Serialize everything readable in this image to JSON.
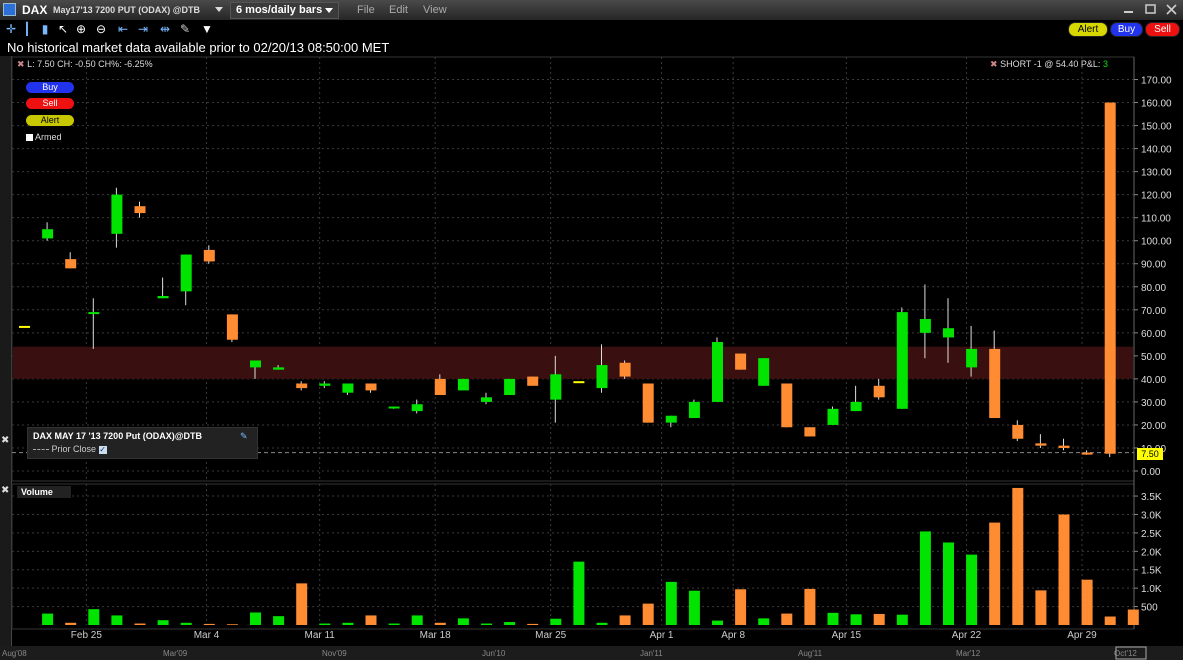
{
  "title_bar": {
    "symbol": "DAX",
    "contract": "May17'13 7200 PUT (ODAX) @DTB",
    "period": "6 mos/daily bars",
    "menu": [
      "File",
      "Edit",
      "View"
    ]
  },
  "toolbar": {
    "icons": [
      "crosshair-icon",
      "bar-chart-icon",
      "candle-chart-icon",
      "pointer-icon",
      "zoom-in-icon",
      "zoom-out-icon",
      "scroll-left-icon",
      "scroll-right-icon",
      "settings-icon",
      "dropdown-icon"
    ],
    "alert_label": "Alert",
    "buy_label": "Buy",
    "sell_label": "Sell"
  },
  "message": "No historical market data available prior to 02/20/13 08:50:00 MET",
  "price_header": {
    "stats": "L: 7.50 CH: -0.50 CH%: -6.25%",
    "position": "SHORT -1 @ 54.40 P&L:",
    "pnl": "3"
  },
  "quick_buttons": {
    "buy": "Buy",
    "sell": "Sell",
    "alert": "Alert",
    "armed": "Armed"
  },
  "legend": {
    "title": "DAX MAY 17 '13 7200 Put (ODAX)@DTB",
    "prior_close": "Prior Close"
  },
  "last_price_tag": "7.50",
  "volume_panel_title": "Volume",
  "colors": {
    "up": "#00e400",
    "down": "#ff8c32",
    "band": "#3a0f0f",
    "last_tag": "#ffff00"
  },
  "chart_data": [
    {
      "type": "candlestick",
      "ylim": [
        0,
        175
      ],
      "yticks": [
        "0.00",
        "10.00",
        "20.00",
        "30.00",
        "40.00",
        "50.00",
        "60.00",
        "70.00",
        "80.00",
        "90.00",
        "100.00",
        "110.00",
        "120.00",
        "130.00",
        "140.00",
        "150.00",
        "160.00",
        "170.00"
      ],
      "date_labels": [
        "Feb 25",
        "Mar 4",
        "Mar 11",
        "Mar 18",
        "Mar 25",
        "Apr 1",
        "Apr 8",
        "Apr 15",
        "Apr 22",
        "Apr 29"
      ],
      "overview_labels": [
        "Aug'08",
        "Mar'09",
        "Nov'09",
        "Jun'10",
        "Jan'11",
        "Aug'11",
        "Mar'12",
        "Oct'12"
      ],
      "position_band": [
        40,
        54
      ],
      "prior_close": 8,
      "bars": [
        {
          "o": 63,
          "h": 63,
          "l": 63,
          "c": 63,
          "dir": "flat"
        },
        {
          "o": 101,
          "h": 108,
          "l": 100,
          "c": 105,
          "dir": "up"
        },
        {
          "o": 92,
          "h": 95,
          "l": 88,
          "c": 88,
          "dir": "down"
        },
        {
          "o": 69,
          "h": 75,
          "l": 53,
          "c": 69,
          "dir": "up"
        },
        {
          "o": 103,
          "h": 123,
          "l": 97,
          "c": 120,
          "dir": "up"
        },
        {
          "o": 115,
          "h": 117,
          "l": 110,
          "c": 112,
          "dir": "down"
        },
        {
          "o": 75,
          "h": 84,
          "l": 75,
          "c": 76,
          "dir": "up"
        },
        {
          "o": 78,
          "h": 94,
          "l": 72,
          "c": 94,
          "dir": "up"
        },
        {
          "o": 96,
          "h": 98,
          "l": 90,
          "c": 91,
          "dir": "down"
        },
        {
          "o": 68,
          "h": 68,
          "l": 56,
          "c": 57,
          "dir": "down"
        },
        {
          "o": 45,
          "h": 48,
          "l": 40,
          "c": 48,
          "dir": "up"
        },
        {
          "o": 44,
          "h": 46,
          "l": 44,
          "c": 45,
          "dir": "up"
        },
        {
          "o": 38,
          "h": 39,
          "l": 35,
          "c": 36,
          "dir": "down"
        },
        {
          "o": 37,
          "h": 39,
          "l": 36,
          "c": 38,
          "dir": "up"
        },
        {
          "o": 34,
          "h": 38,
          "l": 33,
          "c": 38,
          "dir": "up"
        },
        {
          "o": 38,
          "h": 38,
          "l": 34,
          "c": 35,
          "dir": "down"
        },
        {
          "o": 28,
          "h": 28,
          "l": 27,
          "c": 28,
          "dir": "up"
        },
        {
          "o": 26,
          "h": 31,
          "l": 25,
          "c": 29,
          "dir": "up"
        },
        {
          "o": 40,
          "h": 42,
          "l": 33,
          "c": 33,
          "dir": "down"
        },
        {
          "o": 35,
          "h": 40,
          "l": 35,
          "c": 40,
          "dir": "up"
        },
        {
          "o": 30,
          "h": 34,
          "l": 29,
          "c": 32,
          "dir": "up"
        },
        {
          "o": 33,
          "h": 40,
          "l": 33,
          "c": 40,
          "dir": "up"
        },
        {
          "o": 41,
          "h": 41,
          "l": 37,
          "c": 37,
          "dir": "down"
        },
        {
          "o": 31,
          "h": 50,
          "l": 21,
          "c": 42,
          "dir": "up"
        },
        {
          "o": 39,
          "h": 39,
          "l": 39,
          "c": 39,
          "dir": "flat"
        },
        {
          "o": 36,
          "h": 55,
          "l": 34,
          "c": 46,
          "dir": "up"
        },
        {
          "o": 47,
          "h": 48,
          "l": 40,
          "c": 41,
          "dir": "down"
        },
        {
          "o": 38,
          "h": 38,
          "l": 21,
          "c": 21,
          "dir": "down"
        },
        {
          "o": 21,
          "h": 24,
          "l": 19,
          "c": 24,
          "dir": "up"
        },
        {
          "o": 23,
          "h": 31,
          "l": 23,
          "c": 30,
          "dir": "up"
        },
        {
          "o": 30,
          "h": 58,
          "l": 30,
          "c": 56,
          "dir": "up"
        },
        {
          "o": 51,
          "h": 51,
          "l": 44,
          "c": 44,
          "dir": "down"
        },
        {
          "o": 37,
          "h": 49,
          "l": 37,
          "c": 49,
          "dir": "up"
        },
        {
          "o": 38,
          "h": 38,
          "l": 19,
          "c": 19,
          "dir": "down"
        },
        {
          "o": 19,
          "h": 19,
          "l": 15,
          "c": 15,
          "dir": "down"
        },
        {
          "o": 20,
          "h": 28,
          "l": 20,
          "c": 27,
          "dir": "up"
        },
        {
          "o": 26,
          "h": 37,
          "l": 26,
          "c": 30,
          "dir": "up"
        },
        {
          "o": 37,
          "h": 40,
          "l": 31,
          "c": 32,
          "dir": "down"
        },
        {
          "o": 27,
          "h": 71,
          "l": 27,
          "c": 69,
          "dir": "up"
        },
        {
          "o": 60,
          "h": 81,
          "l": 49,
          "c": 66,
          "dir": "up"
        },
        {
          "o": 58,
          "h": 75,
          "l": 47,
          "c": 62,
          "dir": "up"
        },
        {
          "o": 45,
          "h": 63,
          "l": 41,
          "c": 53,
          "dir": "up"
        },
        {
          "o": 53,
          "h": 61,
          "l": 23,
          "c": 23,
          "dir": "down"
        },
        {
          "o": 20,
          "h": 22,
          "l": 13,
          "c": 14,
          "dir": "down"
        },
        {
          "o": 12,
          "h": 16,
          "l": 10,
          "c": 11,
          "dir": "down"
        },
        {
          "o": 11,
          "h": 14,
          "l": 9,
          "c": 10,
          "dir": "down"
        },
        {
          "o": 8,
          "h": 9,
          "l": 7,
          "c": 8,
          "dir": "down"
        },
        {
          "o": 160,
          "h": 160,
          "l": 6,
          "c": 7.5,
          "dir": "down"
        }
      ]
    },
    {
      "type": "bar",
      "title": "Volume",
      "ylim": [
        0,
        3800
      ],
      "yticks": [
        "500",
        "1.0K",
        "1.5K",
        "2.0K",
        "2.5K",
        "3.0K",
        "3.5K"
      ],
      "values": [
        0,
        310,
        60,
        430,
        260,
        40,
        130,
        60,
        30,
        20,
        340,
        240,
        1130,
        40,
        60,
        260,
        40,
        260,
        60,
        180,
        40,
        80,
        30,
        170,
        1720,
        60,
        260,
        580,
        1170,
        930,
        120,
        970,
        180,
        310,
        980,
        330,
        290,
        300,
        280,
        2540,
        2240,
        1910,
        2780,
        3720,
        940,
        3000,
        1230,
        230
      ],
      "last_value": 420,
      "colors": [
        "flat",
        "up",
        "down",
        "up",
        "up",
        "down",
        "up",
        "up",
        "down",
        "down",
        "up",
        "up",
        "down",
        "up",
        "up",
        "down",
        "up",
        "up",
        "down",
        "up",
        "up",
        "up",
        "down",
        "up",
        "up",
        "up",
        "down",
        "down",
        "up",
        "up",
        "up",
        "down",
        "up",
        "down",
        "down",
        "up",
        "up",
        "down",
        "up",
        "up",
        "up",
        "up",
        "down",
        "down",
        "down",
        "down",
        "down"
      ]
    }
  ]
}
